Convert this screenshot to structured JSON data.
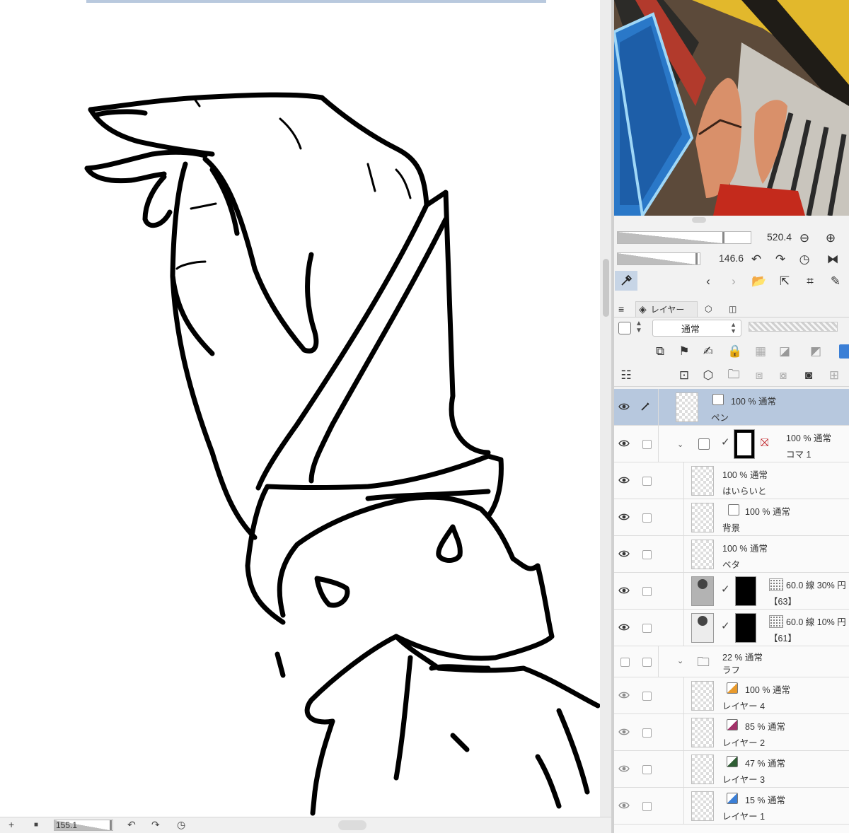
{
  "colors": {
    "selection": "#b7c8de",
    "panel_bg": "#f2f2f2",
    "canvas_bg": "#ffffff",
    "accent_blue": "#3b7fd6"
  },
  "navigator": {
    "zoom_value": "520.4",
    "rotate_value": "146.6"
  },
  "layer_panel": {
    "tab_label": "レイヤー",
    "blend_mode": "通常",
    "layers": [
      {
        "opacity": "100 %",
        "mode": "通常",
        "name": "ペン",
        "selected": true,
        "visible": true
      },
      {
        "opacity": "100 %",
        "mode": "通常",
        "name": "コマ 1",
        "visible": true,
        "is_folder": true
      },
      {
        "opacity": "100 %",
        "mode": "通常",
        "name": "はいらいと",
        "visible": true
      },
      {
        "opacity": "100 %",
        "mode": "通常",
        "name": "背景",
        "visible": true
      },
      {
        "opacity": "100 %",
        "mode": "通常",
        "name": "ベタ",
        "visible": true
      },
      {
        "tone": "60.0 線 30% 円",
        "name": "【63】",
        "visible": true
      },
      {
        "tone": "60.0 線 10% 円",
        "name": "【61】",
        "visible": true
      },
      {
        "opacity": "22 %",
        "mode": "通常",
        "name": "ラフ",
        "visible": false,
        "is_folder": true
      },
      {
        "opacity": "100 %",
        "mode": "通常",
        "name": "レイヤー 4",
        "visible": true
      },
      {
        "opacity": "85 %",
        "mode": "通常",
        "name": "レイヤー 2",
        "visible": true
      },
      {
        "opacity": "47 %",
        "mode": "通常",
        "name": "レイヤー 3",
        "visible": true
      },
      {
        "opacity": "15 %",
        "mode": "通常",
        "name": "レイヤー 1",
        "visible": true
      }
    ]
  },
  "status_bar": {
    "add_label": "+",
    "zoom_value": "155.1"
  }
}
